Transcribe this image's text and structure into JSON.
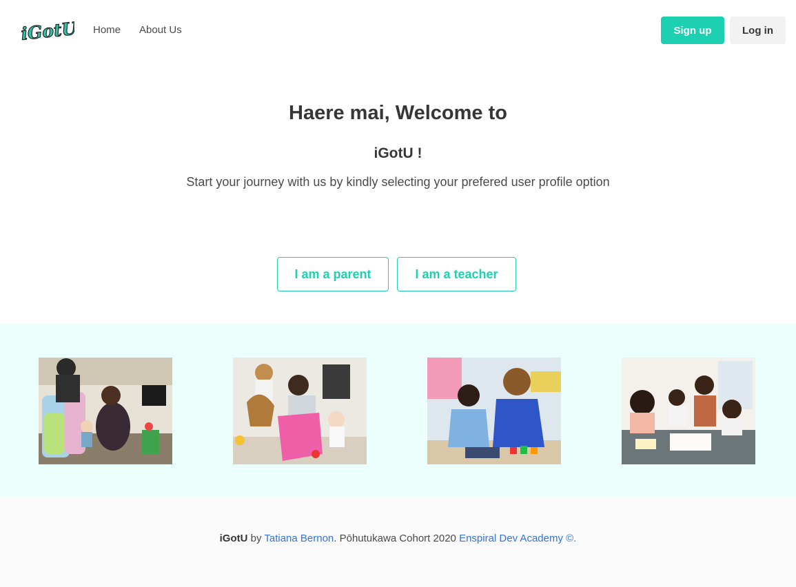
{
  "nav": {
    "logo_text": "iGotU",
    "links": [
      "Home",
      "About Us"
    ],
    "signup_label": "Sign up",
    "login_label": "Log in"
  },
  "hero": {
    "title": "Haere mai, Welcome to",
    "subtitle": "iGotU !",
    "text": "Start your journey with us by kindly selecting your prefered user profile option"
  },
  "roles": {
    "parent_label": "I am a parent",
    "teacher_label": "I am a teacher"
  },
  "gallery": {
    "photos": [
      "family-playpen-photo",
      "mother-toddlers-toys-photo",
      "teacher-boy-playing-photo",
      "children-drawing-table-photo"
    ]
  },
  "footer": {
    "brand": "iGotU",
    "by": " by ",
    "author": "Tatiana Bernon",
    "cohort": ". Pōhutukawa Cohort 2020 ",
    "academy": "Enspiral Dev Academy ©."
  },
  "colors": {
    "accent": "#1ed0b2",
    "gallery_bg": "#ebfffc",
    "link": "#3273dc"
  }
}
